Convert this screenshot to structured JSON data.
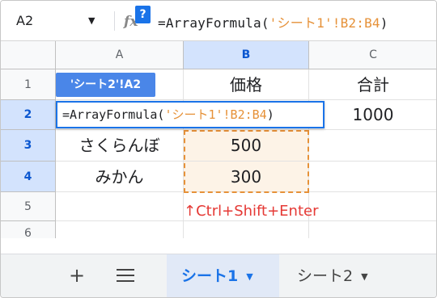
{
  "name_box": {
    "value": "A2",
    "dropdown_icon": "caret-down-icon"
  },
  "formula_bar": {
    "fx_label": "fx",
    "help_badge": "?",
    "formula_prefix": "=ArrayFormula(",
    "formula_string": "'シート1'!B2:B4",
    "formula_suffix": ")"
  },
  "columns": [
    "A",
    "B",
    "C"
  ],
  "rows": [
    "1",
    "2",
    "3",
    "4",
    "5",
    "6"
  ],
  "cells": {
    "B1": "価格",
    "C1": "合計",
    "C2": "1000",
    "A3": "さくらんぼ",
    "B3": "500",
    "A4": "みかん",
    "B4": "300"
  },
  "ref_chip": "'シート2'!A2",
  "editor": {
    "prefix": "=ArrayFormula(",
    "string": "'シート1'!B2:B4",
    "suffix": ")"
  },
  "annotation": "↑Ctrl+Shift+Enter",
  "sheets": [
    {
      "label": "シート1",
      "active": true
    },
    {
      "label": "シート2",
      "active": false
    }
  ],
  "sheet_controls": {
    "add": "+"
  },
  "colors": {
    "accent": "#1a73e8",
    "reference_orange": "#e69138",
    "annotation_red": "#e53935"
  }
}
